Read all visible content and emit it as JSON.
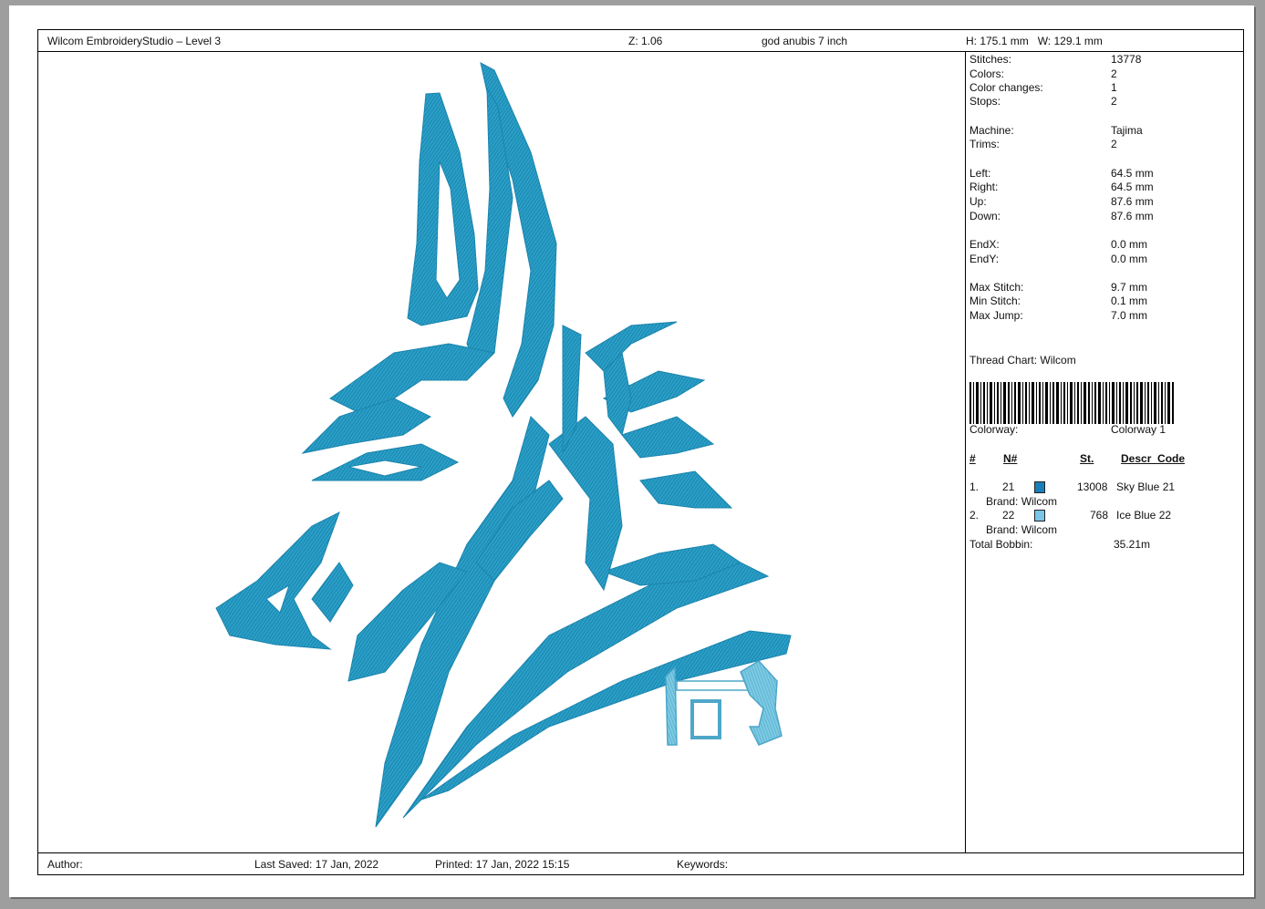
{
  "header": {
    "app_title": "Wilcom EmbroideryStudio – Level 3",
    "zoom": "Z: 1.06",
    "design_name": "god anubis 7 inch",
    "size": "H: 175.1 mm   W: 129.1 mm"
  },
  "stats": [
    {
      "label": "Stitches:",
      "value": "13778"
    },
    {
      "label": "Colors:",
      "value": "2"
    },
    {
      "label": "Color changes:",
      "value": "1"
    },
    {
      "label": "Stops:",
      "value": "2"
    },
    {
      "label": "Machine:",
      "value": "Tajima"
    },
    {
      "label": "Trims:",
      "value": "2"
    },
    {
      "label": "Left:",
      "value": "64.5 mm"
    },
    {
      "label": "Right:",
      "value": "64.5 mm"
    },
    {
      "label": "Up:",
      "value": "87.6 mm"
    },
    {
      "label": "Down:",
      "value": "87.6 mm"
    },
    {
      "label": "EndX:",
      "value": "0.0 mm"
    },
    {
      "label": "EndY:",
      "value": "0.0 mm"
    },
    {
      "label": "Max Stitch:",
      "value": "9.7 mm"
    },
    {
      "label": "Min Stitch:",
      "value": "0.1 mm"
    },
    {
      "label": "Max Jump:",
      "value": "7.0 mm"
    }
  ],
  "thread_chart": "Thread Chart: Wilcom",
  "colorway": {
    "label": "Colorway:",
    "value": "Colorway 1"
  },
  "color_table": {
    "headers": {
      "index": "#",
      "number": "N#",
      "stitches": "St.",
      "descr": "Descr_Code"
    },
    "rows": [
      {
        "index": "1.",
        "number": "21",
        "color": "#1a7fb8",
        "stitches": "13008",
        "descr": "Sky Blue 21",
        "brand": "Brand: Wilcom"
      },
      {
        "index": "2.",
        "number": "22",
        "color": "#7cc4e8",
        "stitches": "768",
        "descr": "Ice Blue 22",
        "brand": "Brand: Wilcom"
      }
    ],
    "total_label": "Total Bobbin:",
    "total_value": "35.21m"
  },
  "footer": {
    "author": "Author:",
    "last_saved": "Last Saved: 17 Jan, 2022",
    "printed": "Printed: 17 Jan, 2022 15:15",
    "keywords": "Keywords:"
  },
  "design_colors": {
    "primary": "#2a9fc8",
    "secondary": "#7ecbe4"
  }
}
